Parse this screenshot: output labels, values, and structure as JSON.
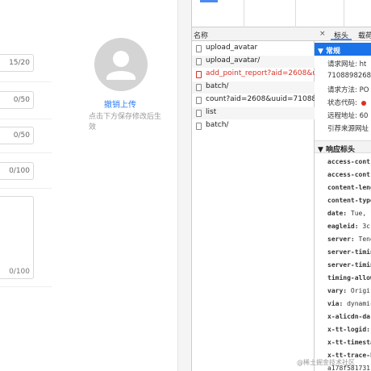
{
  "form": {
    "fields": [
      {
        "count": "15/20"
      },
      {
        "count": "0/50"
      },
      {
        "count": "0/50"
      },
      {
        "count": "0/100"
      }
    ],
    "textarea_count": "0/100"
  },
  "avatar_panel": {
    "upload_link": "撤销上传",
    "hint": "点击下方保存修改后生效"
  },
  "network": {
    "header": "名称",
    "requests": [
      {
        "name": "upload_avatar",
        "error": false
      },
      {
        "name": "upload_avatar/",
        "error": false
      },
      {
        "name": "add_point_report?aid=2608&uu...",
        "error": true
      },
      {
        "name": "batch/",
        "error": false
      },
      {
        "name": "count?aid=2608&uuid=710889...",
        "error": false
      },
      {
        "name": "list",
        "error": false
      },
      {
        "name": "batch/",
        "error": false
      }
    ]
  },
  "details": {
    "close": "×",
    "tabs": [
      "标头",
      "载荷"
    ],
    "general_title": "▼ 常规",
    "general": [
      {
        "text": "请求网址: ht"
      },
      {
        "text": "71088982685"
      },
      {
        "text": "请求方法: PO"
      },
      {
        "text": "状态代码: "
      },
      {
        "text": "远程地址: 60"
      },
      {
        "text": "引荐来源网址"
      }
    ],
    "response_title": "▼ 响应标头",
    "headers": [
      {
        "key": "access-contro",
        "val": ""
      },
      {
        "key": "access-contro",
        "val": ""
      },
      {
        "key": "content-leng",
        "val": ""
      },
      {
        "key": "content-type",
        "val": ""
      },
      {
        "key": "date:",
        "val": " Tue, 1"
      },
      {
        "key": "eagleid:",
        "val": " 3c1"
      },
      {
        "key": "server:",
        "val": " Teng"
      },
      {
        "key": "server-timing",
        "val": ""
      },
      {
        "key": "server-timing",
        "val": ""
      },
      {
        "key": "timing-allow",
        "val": ""
      },
      {
        "key": "vary:",
        "val": " Origi"
      },
      {
        "key": "via:",
        "val": " dynamic"
      },
      {
        "key": "x-alicdn-da-",
        "val": ""
      },
      {
        "key": "x-tt-logid:",
        "val": " 2"
      },
      {
        "key": "x-tt-timestan",
        "val": ""
      },
      {
        "key": "x-tt-trace-ho",
        "val": ""
      },
      {
        "key": "",
        "val": "a178f581731"
      }
    ]
  },
  "watermark": "@稀土掘金技术社区"
}
